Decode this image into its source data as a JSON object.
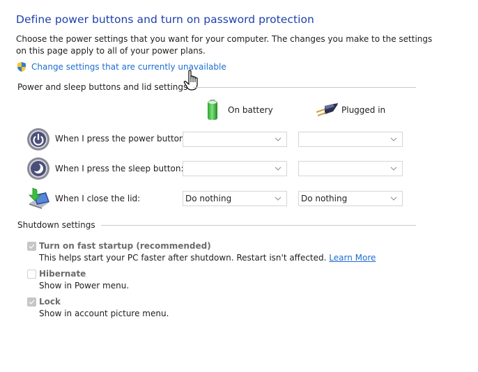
{
  "page": {
    "title": "Define power buttons and turn on password protection",
    "description": "Choose the power settings that you want for your computer. The changes you make to the settings on this page apply to all of your power plans.",
    "admin_link": {
      "icon": "uac-shield-icon",
      "label": "Change settings that are currently unavailable"
    }
  },
  "power_section": {
    "heading": "Power and sleep buttons and lid settings",
    "columns": [
      {
        "icon": "battery-icon",
        "label": "On battery"
      },
      {
        "icon": "power-plug-icon",
        "label": "Plugged in"
      }
    ],
    "rows": [
      {
        "icon": "power-button-icon",
        "label": "When I press the power button:",
        "on_battery": "",
        "plugged_in": ""
      },
      {
        "icon": "sleep-button-icon",
        "label": "When I press the sleep button:",
        "on_battery": "",
        "plugged_in": ""
      },
      {
        "icon": "close-lid-icon",
        "label": "When I close the lid:",
        "on_battery": "Do nothing",
        "plugged_in": "Do nothing"
      }
    ]
  },
  "shutdown_section": {
    "heading": "Shutdown settings",
    "options": [
      {
        "label": "Turn on fast startup (recommended)",
        "checked": true,
        "disabled": true,
        "description": "This helps start your PC faster after shutdown. Restart isn't affected.",
        "link": "Learn More"
      },
      {
        "label": "Hibernate",
        "checked": false,
        "disabled": true,
        "description": "Show in Power menu."
      },
      {
        "label": "Lock",
        "checked": true,
        "disabled": true,
        "description": "Show in account picture menu."
      }
    ]
  },
  "colors": {
    "title": "#1e3fae",
    "link": "#1c6dd0",
    "disabled_text": "#6b6b6b"
  }
}
